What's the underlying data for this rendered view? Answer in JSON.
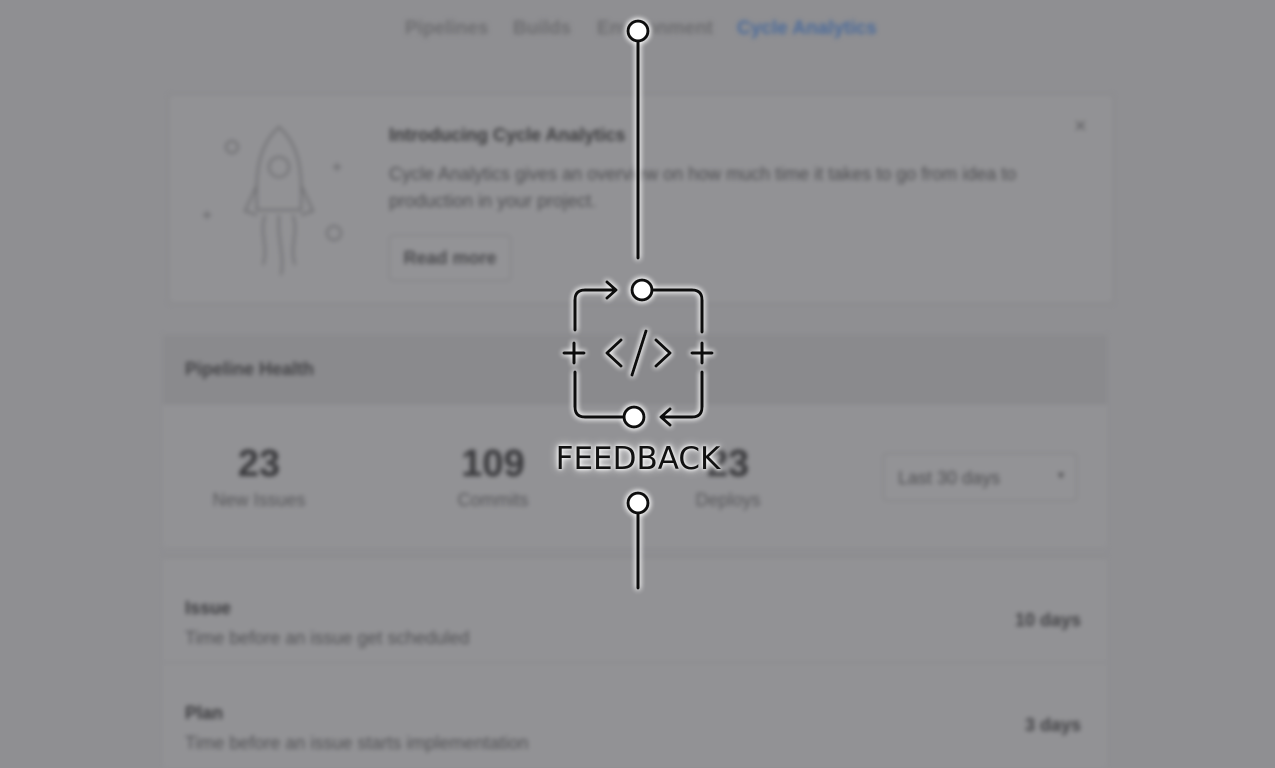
{
  "nav": {
    "items": [
      {
        "label": "Pipelines",
        "active": false
      },
      {
        "label": "Builds",
        "active": false
      },
      {
        "label": "Environment",
        "active": false
      },
      {
        "label": "Cycle Analytics",
        "active": true
      }
    ]
  },
  "intro": {
    "title": "Introducing Cycle Analytics",
    "description": "Cycle Analytics gives an overview on how much time it takes to go from idea to production in your project.",
    "read_more_label": "Read more",
    "close_icon": "×",
    "illustration": "rocket-icon"
  },
  "health": {
    "title": "Pipeline Health",
    "stats": [
      {
        "value": "23",
        "label": "New Issues"
      },
      {
        "value": "109",
        "label": "Commits"
      },
      {
        "value": "23",
        "label": "Deploys"
      }
    ],
    "range_select": {
      "value": "Last 30 days",
      "caret": "▾"
    }
  },
  "stages": [
    {
      "title": "Issue",
      "description": "Time before an issue get scheduled",
      "value": "10 days"
    },
    {
      "title": "Plan",
      "description": "Time before an issue starts implementation",
      "value": "3 days"
    }
  ],
  "overlay": {
    "label": "FEEDBACK",
    "icon": "code-feedback-loop-icon",
    "line_color": "#111111",
    "glow_color": "#ffffff"
  }
}
